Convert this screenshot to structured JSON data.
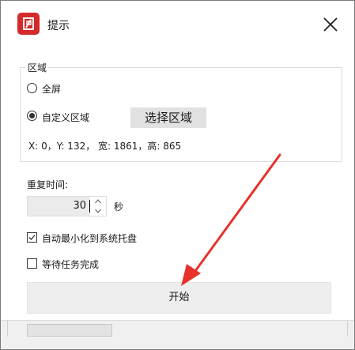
{
  "window": {
    "title": "提示",
    "app_icon": "app-logo-icon",
    "close_icon": "close-icon"
  },
  "region": {
    "group_title": "区域",
    "options": [
      {
        "label": "全屏",
        "checked": false
      },
      {
        "label": "自定义区域",
        "checked": true
      }
    ],
    "select_button_label": "选择区域",
    "coords_text": "X: 0，Y: 132， 宽: 1861，高: 865"
  },
  "repeat": {
    "label": "重复时间:",
    "value": "30",
    "unit": "秒"
  },
  "checkboxes": [
    {
      "label": "自动最小化到系统托盘",
      "checked": true
    },
    {
      "label": "等待任务完成",
      "checked": false
    }
  ],
  "start_button_label": "开始",
  "status": {
    "progress_fraction": 0
  },
  "colors": {
    "app_icon_red": "#d32a2a",
    "annotation_arrow_red": "#e8312a",
    "button_gray": "#e1e1e1",
    "start_button_gray": "#eeeeee"
  }
}
